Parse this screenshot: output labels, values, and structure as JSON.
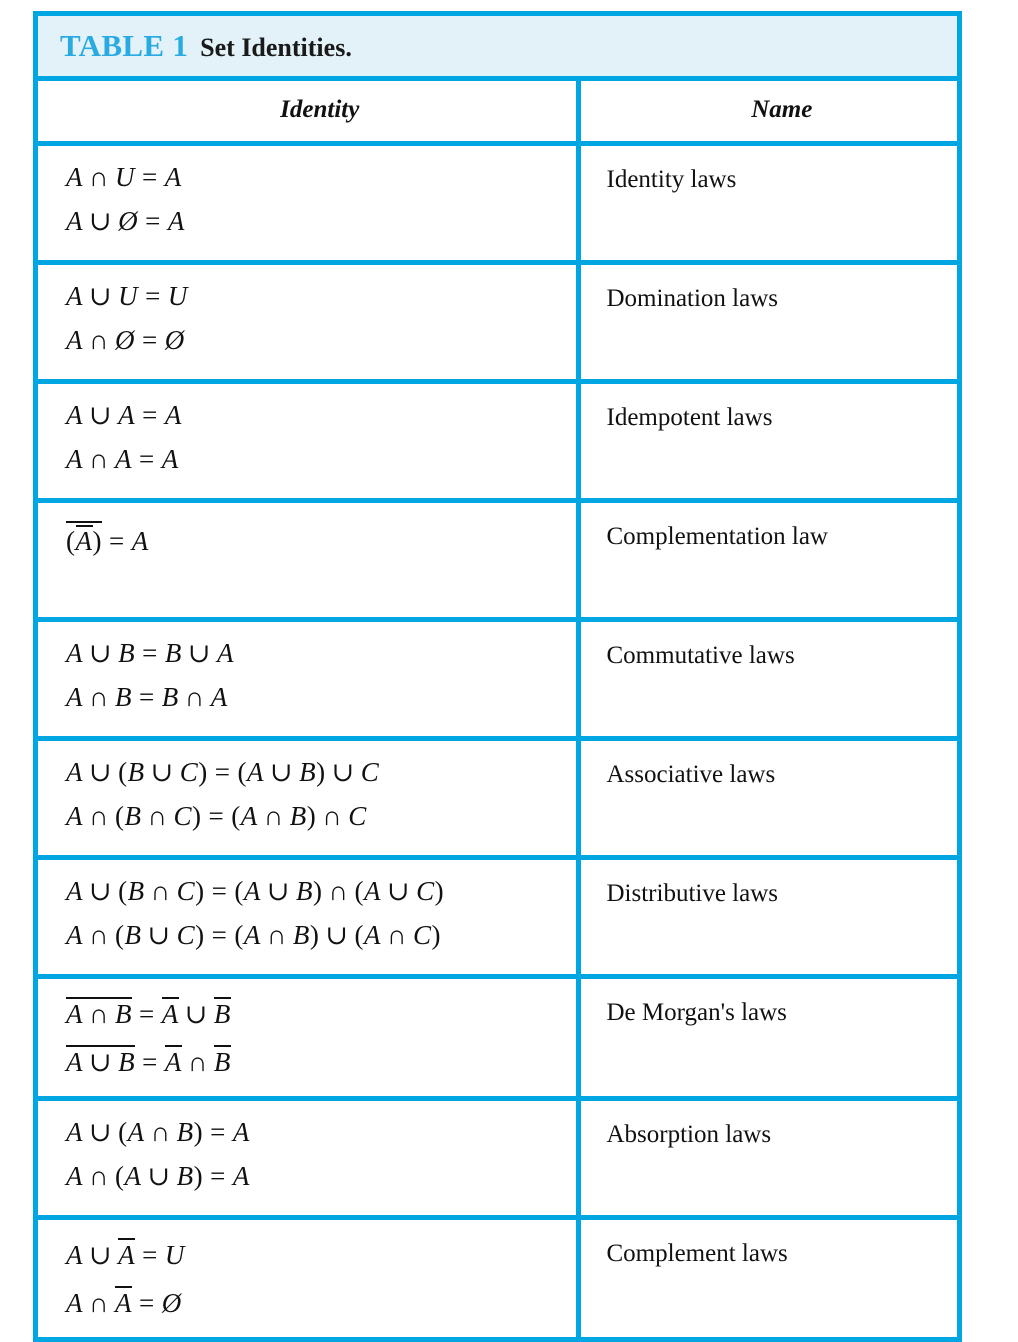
{
  "title": {
    "label": "TABLE 1",
    "caption": "Set Identities.",
    "label_color": "#29abe2",
    "bar_background": "#e3f1f9"
  },
  "style": {
    "border_color": "#00a6e2",
    "text_color": "#111111"
  },
  "columns": {
    "identity_header": "Identity",
    "name_header": "Name"
  },
  "rows": [
    {
      "name": "Identity laws",
      "equations": [
        "A ∩ U = A",
        "A ∪ Ø = A"
      ]
    },
    {
      "name": "Domination laws",
      "equations": [
        "A ∪ U = U",
        "A ∩ Ø = Ø"
      ]
    },
    {
      "name": "Idempotent laws",
      "equations": [
        "A ∪ A = A",
        "A ∩ A = A"
      ]
    },
    {
      "name": "Complementation law",
      "equations": [
        "(A̅)̅ = A"
      ]
    },
    {
      "name": "Commutative laws",
      "equations": [
        "A ∪ B = B ∪ A",
        "A ∩ B = B ∩ A"
      ]
    },
    {
      "name": "Associative laws",
      "equations": [
        "A ∪ (B ∪ C) = (A ∪ B) ∪ C",
        "A ∩ (B ∩ C) = (A ∩ B) ∩ C"
      ]
    },
    {
      "name": "Distributive laws",
      "equations": [
        "A ∪ (B ∩ C) = (A ∪ B) ∩ (A ∪ C)",
        "A ∩ (B ∪ C) = (A ∩ B) ∪ (A ∩ C)"
      ]
    },
    {
      "name": "De Morgan's laws",
      "equations": [
        "̅A ∩ B̅ = A̅ ∪ B̅",
        "̅A ∪ B̅ = A̅ ∩ B̅"
      ]
    },
    {
      "name": "Absorption laws",
      "equations": [
        "A ∪ (A ∩ B) = A",
        "A ∩ (A ∪ B) = A"
      ]
    },
    {
      "name": "Complement laws",
      "equations": [
        "A ∪ A̅ = U",
        "A ∩ A̅ = Ø"
      ]
    }
  ],
  "symbols": {
    "union": "∪",
    "intersection": "∩",
    "equals": "=",
    "empty_set": "Ø",
    "universe": "U",
    "set_a": "A",
    "set_b": "B",
    "set_c": "C",
    "lparen": "(",
    "rparen": ")"
  }
}
